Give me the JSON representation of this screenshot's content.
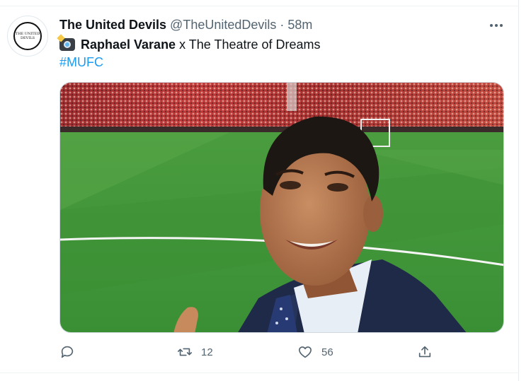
{
  "tweet": {
    "display_name": "The United Devils",
    "handle": "@TheUnitedDevils",
    "separator": "·",
    "time": "58m",
    "text_bold": "Raphael Varane",
    "text_rest": " x The Theatre of Dreams",
    "hashtag": "#MUFC",
    "emoji_icon": "camera-flash-icon",
    "avatar_text": [
      "THE UNITED",
      "DEVILS"
    ]
  },
  "actions": {
    "reply_count": "",
    "retweet_count": "12",
    "like_count": "56"
  },
  "colors": {
    "link": "#1d9bf0",
    "secondary_text": "#536471",
    "pitch_green": "#3f9a3a",
    "crowd_red": "#b3262a"
  }
}
